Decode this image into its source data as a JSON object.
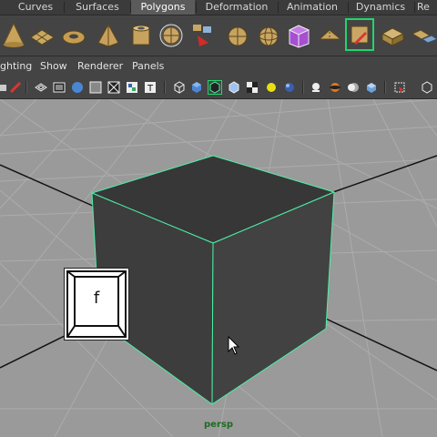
{
  "shelf_tabs": [
    {
      "label": "Curves",
      "active": false
    },
    {
      "label": "Surfaces",
      "active": false
    },
    {
      "label": "Polygons",
      "active": true
    },
    {
      "label": "Deformation",
      "active": false
    },
    {
      "label": "Animation",
      "active": false
    },
    {
      "label": "Dynamics",
      "active": false
    },
    {
      "label": "Re",
      "active": false
    }
  ],
  "shelf_icons": [
    "poly-cone-icon",
    "poly-plane-icon",
    "poly-torus-icon",
    "poly-pyramid-icon",
    "poly-pipe-icon",
    "poly-soccerball-icon",
    "combine-icon",
    "separate-icon",
    "extract-icon",
    "smooth-icon",
    "boolean-icon",
    "mirror-icon",
    "append-polygon-icon",
    "split-polygon-icon",
    "extrude-face-icon",
    "extrude-edge-icon"
  ],
  "panel_menu": {
    "lighting": "ghting",
    "show": "Show",
    "renderer": "Renderer",
    "panels": "Panels"
  },
  "viewport": {
    "camera_label": "persp",
    "selected_object": "cube",
    "wireframe_highlight_color": "#4cf0a6"
  },
  "keystroke_overlay": {
    "key": "f"
  },
  "colors": {
    "viewport_background": "#9a9a9a",
    "grid_line": "#a9a9a9",
    "axis_line": "#111111",
    "cube_face": "#3d3d3d",
    "cube_edge": "#4cf0a6",
    "camera_label": "#1f6b23"
  }
}
